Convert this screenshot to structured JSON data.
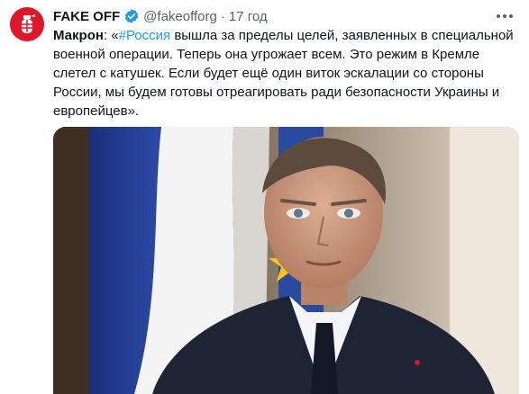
{
  "tweet": {
    "author_name": "FAKE OFF",
    "author_handle": "@fakeofforg",
    "separator": "·",
    "time": "17 год",
    "text": {
      "lead": "Макрон",
      "colon": ": «",
      "hashtag": "#Россия",
      "body": " вышла за пределы целей, заявленных в специальной военной операции. Теперь она угрожает всем. Это режим в Кремле слетел с катушек. Если будет ещё один виток эскалации со стороны России, мы будем готовы отреагировать ради безопасности Украины и европейцев»."
    }
  },
  "icons": {
    "avatar": "grenade-logo-icon",
    "verified": "verified-badge-icon",
    "more": "more-options-icon"
  },
  "colors": {
    "avatar_bg": "#e0162b",
    "verified": "#1d9bf0",
    "hashtag": "#1d9bf0",
    "secondary_text": "#536471"
  }
}
